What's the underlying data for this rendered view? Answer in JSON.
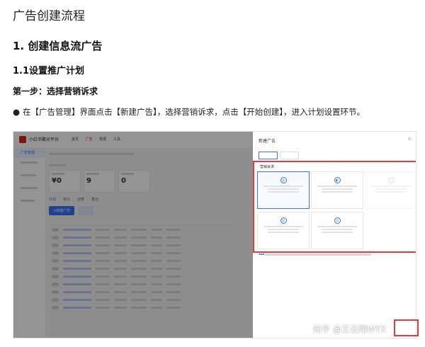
{
  "document": {
    "title": "广告创建流程",
    "h1": "1. 创建信息流广告",
    "h2": "1.1设置推广计划",
    "h3": "第一步：选择营销诉求",
    "paragraph": "在【广告管理】界面点击【新建广告】，选择营销诉求，点击【开始创建】，进入计划设置环节。"
  },
  "screenshot": {
    "app_name": "小红书聚光平台",
    "nav": [
      "首页",
      "广告",
      "数据",
      "工具"
    ],
    "sidebar": [
      "广告管理",
      "",
      "",
      "",
      "",
      ""
    ],
    "cards": [
      {
        "label": "",
        "value": "¥0"
      },
      {
        "label": "",
        "value": "9"
      },
      {
        "label": "",
        "value": "0"
      }
    ],
    "list_tabs": [
      "计划",
      "单元",
      "创意",
      "笔记"
    ],
    "new_button": "+新建广告",
    "dialog": {
      "title": "新建广告",
      "close": "×",
      "tabs": [
        "",
        ""
      ],
      "section_label": "营销诉求",
      "options": [
        {
          "title": "",
          "icon": "◎",
          "state": "selected"
        },
        {
          "title": "",
          "icon": "◐",
          "state": "normal"
        },
        {
          "title": "",
          "icon": "□",
          "state": "disabled"
        },
        {
          "title": "",
          "icon": "⇆",
          "state": "normal"
        },
        {
          "title": "",
          "icon": "⊙",
          "state": "normal"
        }
      ],
      "footer": ""
    }
  },
  "watermark": "知乎 @王云翔WYX",
  "colors": {
    "accent": "#3a6ff7",
    "highlight": "#e23b3b",
    "brand": "#e02020"
  }
}
